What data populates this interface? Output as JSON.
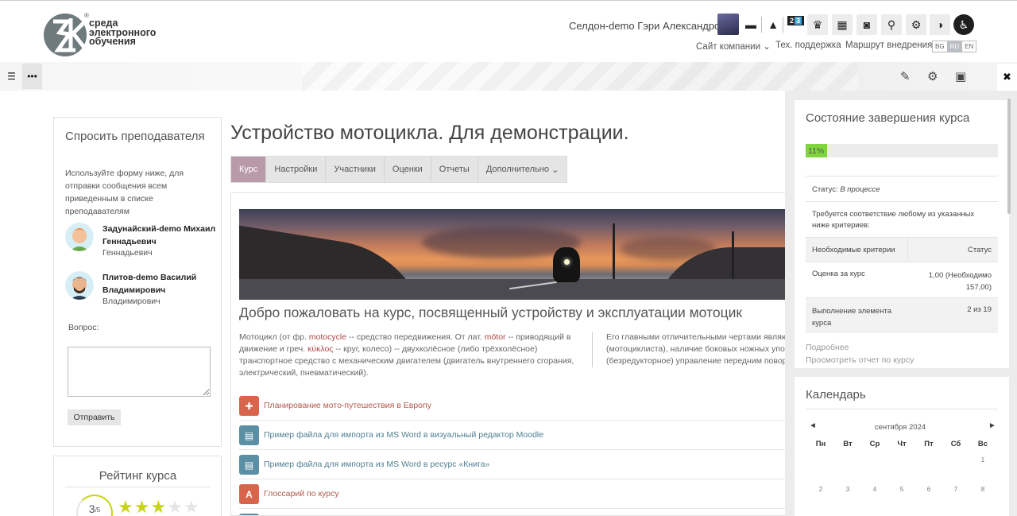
{
  "header": {
    "logo_text": [
      "среда",
      "электронного",
      "обучения"
    ],
    "logo_reg": "®",
    "username": "Селдон-demo Гэри Александрович",
    "notif_badge_a": "2",
    "notif_badge_b": "3",
    "submenu": {
      "company_sites": "Сайт компании",
      "support": "Тех. поддержка",
      "route": "Маршрут внедрения"
    },
    "languages": [
      {
        "code": "BG",
        "active": false
      },
      {
        "code": "RU",
        "active": true
      },
      {
        "code": "EN",
        "active": false
      }
    ],
    "icons": [
      "chat-icon",
      "bell-icon",
      "trophy-icon",
      "dashboard-icon",
      "portrait-icon",
      "search-icon",
      "gear-icon",
      "toggle-icon",
      "accessibility-icon"
    ]
  },
  "ask_block": {
    "title": "Спросить преподавателя",
    "description": "Используйте форму ниже, для отправки сообщения всем приведенным в списке преподавателям",
    "teachers": [
      {
        "name": "Задунайский-demo Михаил Геннадьевич",
        "sub": "Геннадьевич"
      },
      {
        "name": "Плитов-demo Василий Владимирович",
        "sub": "Владимирович"
      }
    ],
    "question_label": "Вопрос:",
    "send_label": "Отправить"
  },
  "rating": {
    "title": "Рейтинг курса",
    "value": "3",
    "unit": "/5",
    "stars_filled": 3,
    "stars_total": 5
  },
  "course": {
    "title": "Устройство мотоцикла. Для демонстрации.",
    "tabs": [
      "Курс",
      "Настройки",
      "Участники",
      "Оценки",
      "Отчеты",
      "Дополнительно"
    ],
    "welcome": "Добро пожаловать на курс, посвященный устройству и эксплуатации мотоцик",
    "desc_left": {
      "p1": "Мотоцикл (от фр. ",
      "w1": "motocycle",
      "p2": " -- средство передвижения. От лат. ",
      "w2": "mōtor",
      "p3": " -- приводящий в движение и греч. ",
      "w3": "κύκλος",
      "p4": " -- круг, колесо) -- двухколёсное (либо трёхколёсное) транспортное средство с механическим двигателем (двигатель внутреннего сгорания, электрический, пневматический)."
    },
    "desc_right": [
      "Его главными отличительными чертами являются",
      "(мотоциклиста), наличие боковых ножных упоров",
      "(безредукторное) управление передним поворот"
    ],
    "activities": [
      {
        "label": "Планирование мото-путешествия в Европу",
        "color": "#d9644c",
        "icon": "puzzle-icon",
        "glyph": "✚"
      },
      {
        "label": "Пример файла для импорта из MS Word в визуальный редактор Moodle",
        "color": "#5b8fa3",
        "icon": "document-icon",
        "glyph": "▤"
      },
      {
        "label": "Пример файла для импорта из MS Word в ресурс «Книга»",
        "color": "#5b8fa3",
        "icon": "book-icon",
        "glyph": "▤"
      },
      {
        "label": "Глоссарий по курсу",
        "color": "#d9644c",
        "icon": "glossary-icon",
        "glyph": "A"
      }
    ]
  },
  "completion": {
    "title": "Состояние завершения курса",
    "progress_pct": 11,
    "progress_label": "11%",
    "status_label": "Статус:",
    "status_value": "В процессе",
    "requirement": "Требуется соответствие любому из указанных ниже критериев:",
    "col_criteria": "Необходимые критерии",
    "col_status": "Статус",
    "rows": [
      {
        "criteria": "Оценка за курс",
        "status": "1,00 (Необходимо 157,00)"
      },
      {
        "criteria": "Выполнение элемента курса",
        "status": "2 из 19"
      }
    ],
    "more": "Подробнее",
    "report": "Просмотреть отчет по курсу"
  },
  "calendar": {
    "title": "Календарь",
    "month": "сентября 2024",
    "prev": "◄",
    "next": "►",
    "weekdays": [
      "Пн",
      "Вт",
      "Ср",
      "Чт",
      "Пт",
      "Сб",
      "Вс"
    ],
    "week1": [
      "",
      "",
      "",
      "",
      "",
      "",
      "1"
    ],
    "week2": [
      "2",
      "3",
      "4",
      "5",
      "6",
      "7",
      "8"
    ]
  },
  "colors": {
    "active_tab": "#b99aa9",
    "progress": "#7ed63a",
    "stars": "#c8d41a",
    "link_red": "#b04646"
  }
}
